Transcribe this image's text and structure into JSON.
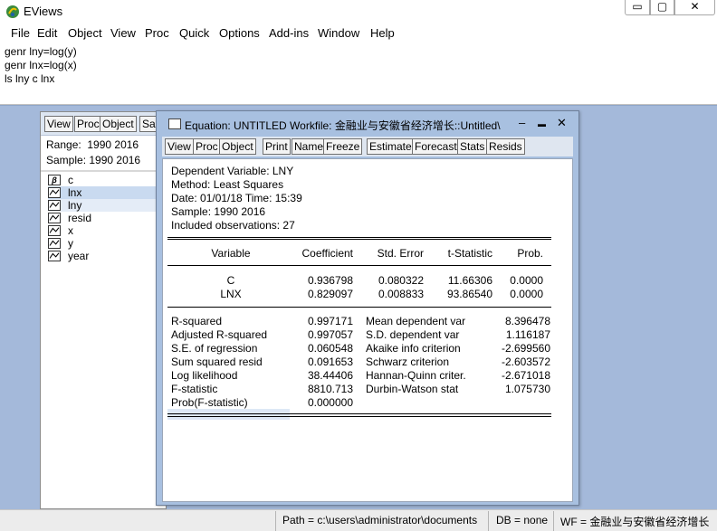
{
  "app": {
    "title": "EViews"
  },
  "window_controls": {
    "minimize": "▭",
    "maximize": "▢",
    "close": "✕"
  },
  "menu": [
    "File",
    "Edit",
    "Object",
    "View",
    "Proc",
    "Quick",
    "Options",
    "Add-ins",
    "Window",
    "Help"
  ],
  "command_window": {
    "lines": [
      "genr  lny=log(y)",
      "genr lnx=log(x)",
      "ls lny c lnx"
    ]
  },
  "workfile": {
    "toolbar": [
      "View",
      "Proc",
      "Object",
      "Sa"
    ],
    "range_label": "Range:",
    "range_value": "1990 2016",
    "sample_label": "Sample:",
    "sample_value": "1990 2016",
    "objects": [
      {
        "name": "c",
        "icon": "beta-icon"
      },
      {
        "name": "lnx",
        "icon": "series-icon"
      },
      {
        "name": "lny",
        "icon": "series-icon"
      },
      {
        "name": "resid",
        "icon": "series-icon"
      },
      {
        "name": "x",
        "icon": "series-icon"
      },
      {
        "name": "y",
        "icon": "series-icon"
      },
      {
        "name": "year",
        "icon": "series-icon"
      }
    ]
  },
  "equation": {
    "title": "Equation: UNTITLED   Workfile: 金融业与安徽省经济增长::Untitled\\",
    "controls": {
      "minimize": "‒",
      "maximize": "▬",
      "close": "✕"
    },
    "toolbar": [
      "View",
      "Proc",
      "Object",
      "Print",
      "Name",
      "Freeze",
      "Estimate",
      "Forecast",
      "Stats",
      "Resids"
    ],
    "header": {
      "dependent": "Dependent Variable: LNY",
      "method": "Method: Least Squares",
      "date": "Date: 01/01/18   Time: 15:39",
      "sample": "Sample: 1990 2016",
      "obs": "Included observations: 27"
    },
    "columns": [
      "Variable",
      "Coefficient",
      "Std. Error",
      "t-Statistic",
      "Prob."
    ],
    "rows": [
      {
        "var": "C",
        "coef": "0.936798",
        "se": "0.080322",
        "t": "11.66306",
        "p": "0.0000"
      },
      {
        "var": "LNX",
        "coef": "0.829097",
        "se": "0.008833",
        "t": "93.86540",
        "p": "0.0000"
      }
    ],
    "stats_left": [
      {
        "label": "R-squared",
        "value": "0.997171"
      },
      {
        "label": "Adjusted R-squared",
        "value": "0.997057"
      },
      {
        "label": "S.E. of regression",
        "value": "0.060548"
      },
      {
        "label": "Sum squared resid",
        "value": "0.091653"
      },
      {
        "label": "Log likelihood",
        "value": "38.44406"
      },
      {
        "label": "F-statistic",
        "value": "8810.713"
      },
      {
        "label": "Prob(F-statistic)",
        "value": "0.000000"
      }
    ],
    "stats_right": [
      {
        "label": "Mean dependent var",
        "value": "8.396478"
      },
      {
        "label": "S.D. dependent var",
        "value": "1.116187"
      },
      {
        "label": "Akaike info criterion",
        "value": "-2.699560"
      },
      {
        "label": "Schwarz criterion",
        "value": "-2.603572"
      },
      {
        "label": "Hannan-Quinn criter.",
        "value": "-2.671018"
      },
      {
        "label": "Durbin-Watson stat",
        "value": "1.075730"
      }
    ]
  },
  "statusbar": {
    "path": "Path = c:\\users\\administrator\\documents",
    "db": "DB = none",
    "wf": "WF = 金融业与安徽省经济增长"
  }
}
